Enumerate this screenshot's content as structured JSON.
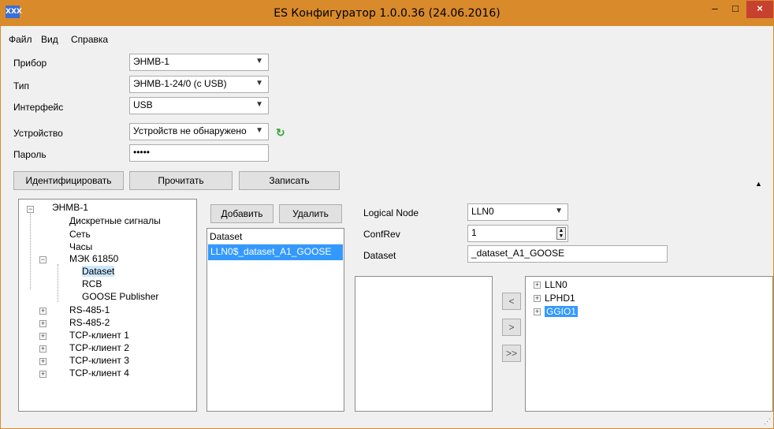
{
  "window": {
    "title": "ES Конфигуратор 1.0.0.36 (24.06.2016)",
    "app_icon": "XXX",
    "minimize": "–",
    "maximize": "□",
    "close": "×"
  },
  "menu": {
    "items": [
      "Файл",
      "Вид",
      "Справка"
    ]
  },
  "form": {
    "device_label": "Прибор",
    "device_value": "ЭНМВ-1",
    "type_label": "Тип",
    "type_value": "ЭНМВ-1-24/0 (с USB)",
    "interface_label": "Интерфейс",
    "interface_value": "USB",
    "unit_label": "Устройство",
    "unit_value": "Устройств не обнаружено",
    "password_label": "Пароль",
    "password_value": "•••••"
  },
  "actions": {
    "identify": "Идентифицировать",
    "read": "Прочитать",
    "write": "Записать"
  },
  "tree": {
    "root": "ЭНМВ-1",
    "items": {
      "discrete": "Дискретные сигналы",
      "net": "Сеть",
      "clock": "Часы",
      "iec": "МЭК 61850",
      "dataset": "Dataset",
      "rcb": "RCB",
      "goose": "GOOSE Publisher",
      "rs1": "RS-485-1",
      "rs2": "RS-485-2",
      "tcp1": "TCP-клиент 1",
      "tcp2": "TCP-клиент 2",
      "tcp3": "TCP-клиент 3",
      "tcp4": "TCP-клиент 4"
    }
  },
  "dataset_panel": {
    "add": "Добавить",
    "remove": "Удалить",
    "header": "Dataset",
    "items": [
      "LLN0$_dataset_A1_GOOSE"
    ]
  },
  "props": {
    "ln_label": "Logical Node",
    "ln_value": "LLN0",
    "confrev_label": "ConfRev",
    "confrev_value": "1",
    "dataset_label": "Dataset",
    "dataset_value": "_dataset_A1_GOOSE"
  },
  "transfer": {
    "left": "<",
    "right": ">",
    "all": ">>"
  },
  "source_tree": {
    "items": [
      "LLN0",
      "LPHD1",
      "GGIO1"
    ]
  }
}
